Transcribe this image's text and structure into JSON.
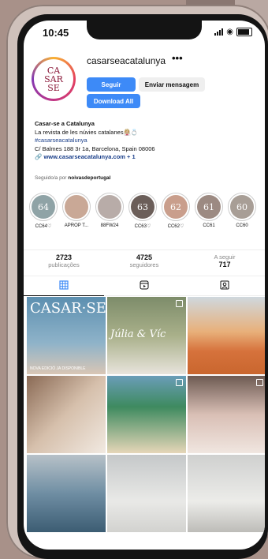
{
  "status": {
    "time": "10:45"
  },
  "profile": {
    "avatar_lines": [
      "CA",
      "SAR",
      "SE"
    ],
    "username": "casarseacatalunya",
    "more": "•••",
    "follow_label": "Seguir",
    "message_label": "Enviar mensagem",
    "download_label": "Download All"
  },
  "bio": {
    "name": "Casar-se a Catalunya",
    "line1": "La revista de les núvies catalanes👰🏼💍",
    "hashtag": "#casarseacatalunya",
    "address": "C/ Balmes 188 3r 1a, Barcelona, Spain 08006",
    "link": "www.casarseacatalunya.com + 1"
  },
  "followed_by": {
    "prefix": "Seguido/a por",
    "user": "noivasdeportugal"
  },
  "highlights": [
    {
      "label": "CC64♡",
      "text": "64",
      "color": "#8fa3a6"
    },
    {
      "label": "APROP T...",
      "text": "",
      "color": "#c9a896"
    },
    {
      "label": "88FW24",
      "text": "",
      "color": "#b8aca8"
    },
    {
      "label": "CC63♡",
      "text": "63",
      "color": "#6b5e59"
    },
    {
      "label": "CC62♡",
      "text": "62",
      "color": "#c99e8c"
    },
    {
      "label": "CC61",
      "text": "61",
      "color": "#9c8a82"
    },
    {
      "label": "CC60",
      "text": "60",
      "color": "#a89e96"
    }
  ],
  "stats": [
    {
      "value": "2723",
      "label": "publicações"
    },
    {
      "value": "4725",
      "label": "seguidores"
    },
    {
      "value": "717",
      "label": "A seguir"
    }
  ],
  "grid": [
    {
      "text": "CASAR·SE",
      "sub": "NOVA EDICIÓ JA DISPONIBLE",
      "bg": "linear-gradient(180deg,#5c8fb0,#8fb3c9 60%,#d9c6b5)"
    },
    {
      "text": "Júlia & Víc",
      "sub": "",
      "bg": "linear-gradient(180deg,#7d8c6a,#a9b08a 50%,#e8e4dc)"
    },
    {
      "text": "",
      "sub": "",
      "bg": "linear-gradient(180deg,#cfd8de,#e8b07a 45%,#d6723c 70%,#c9662e)"
    },
    {
      "text": "",
      "sub": "",
      "bg": "linear-gradient(135deg,#8a6a55,#d6c0ac 50%,#f1e9e1)"
    },
    {
      "text": "",
      "sub": "",
      "bg": "linear-gradient(180deg,#6a9db8,#3e8a5f 40%,#e6d6b8)"
    },
    {
      "text": "",
      "sub": "",
      "bg": "linear-gradient(180deg,#6d5a52,#d9bfb5 50%,#f0e6e0)"
    },
    {
      "text": "",
      "sub": "",
      "bg": "linear-gradient(180deg,#b7c1c8,#6f8ea3 50%,#3c5d73)"
    },
    {
      "text": "",
      "sub": "",
      "bg": "linear-gradient(180deg,#c5c8c9,#e9e9e7 60%,#d2d2cf)"
    },
    {
      "text": "",
      "sub": "",
      "bg": "linear-gradient(180deg,#cfd0cf,#ecece9 60%,#bdbcb8)"
    }
  ]
}
